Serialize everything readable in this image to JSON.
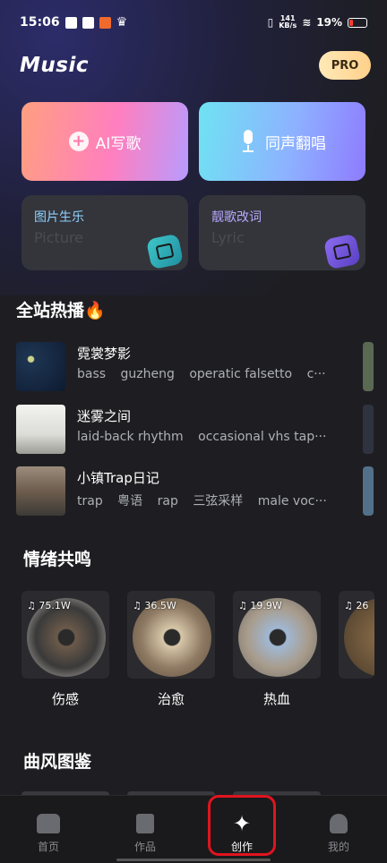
{
  "status_bar": {
    "time": "15:06",
    "net_speed_top": "141",
    "net_speed_bottom": "KB/s",
    "battery": "19%"
  },
  "header": {
    "title": "Music",
    "pro_label": "PRO"
  },
  "create_cards": {
    "ai_write": "AI写歌",
    "cover_sing": "同声翻唱",
    "picture_title": "图片生乐",
    "picture_sub": "Picture",
    "lyric_title": "靓歌改词",
    "lyric_sub": "Lyric"
  },
  "hot": {
    "title": "全站热播🔥",
    "songs": [
      {
        "name": "霓裳梦影",
        "tags": [
          "bass",
          "guzheng",
          "operatic falsetto",
          "c···"
        ]
      },
      {
        "name": "迷雾之间",
        "tags": [
          "laid-back rhythm",
          "occasional vhs tap···"
        ]
      },
      {
        "name": "小镇Trap日记",
        "tags": [
          "trap",
          "粤语",
          "rap",
          "三弦采样",
          "male voc···"
        ]
      }
    ]
  },
  "mood": {
    "title": "情绪共鸣",
    "cards": [
      {
        "count": "75.1W",
        "label": "伤感"
      },
      {
        "count": "36.5W",
        "label": "治愈"
      },
      {
        "count": "19.9W",
        "label": "热血"
      },
      {
        "count": "26",
        "label": ""
      }
    ]
  },
  "style": {
    "title": "曲风图鉴"
  },
  "tabbar": {
    "home": "首页",
    "works": "作品",
    "create": "创作",
    "mine": "我的"
  }
}
